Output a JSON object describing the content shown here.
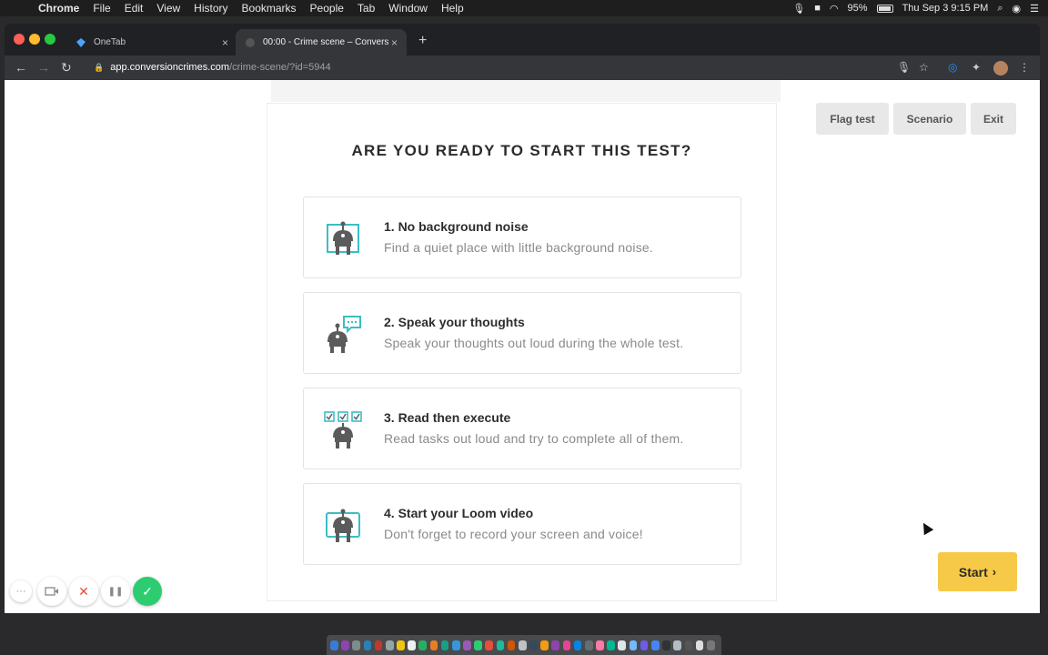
{
  "menubar": {
    "app": "Chrome",
    "items": [
      "File",
      "Edit",
      "View",
      "History",
      "Bookmarks",
      "People",
      "Tab",
      "Window",
      "Help"
    ],
    "battery": "95%",
    "clock": "Thu Sep 3  9:15 PM"
  },
  "tabs": [
    {
      "title": "OneTab",
      "close": "×"
    },
    {
      "title": "00:00 - Crime scene – Convers",
      "close": "×"
    }
  ],
  "new_tab": "+",
  "address": {
    "host": "app.conversioncrimes.com",
    "path": "/crime-scene/?id=5944"
  },
  "page": {
    "heading": "ARE YOU READY TO START THIS TEST?",
    "steps": [
      {
        "title": "1. No background noise",
        "desc": "Find a quiet place with little background noise.",
        "icon": "robot-frame-icon"
      },
      {
        "title": "2. Speak your thoughts",
        "desc": "Speak your thoughts out loud during the whole test.",
        "icon": "robot-speech-icon"
      },
      {
        "title": "3. Read then execute",
        "desc": "Read tasks out loud and try to complete all of them.",
        "icon": "robot-checklist-icon"
      },
      {
        "title": "4. Start your Loom video",
        "desc": "Don't forget to record your screen and voice!",
        "icon": "robot-video-icon"
      }
    ],
    "buttons": {
      "flag": "Flag test",
      "scenario": "Scenario",
      "exit": "Exit",
      "start": "Start"
    }
  },
  "loom": {
    "more": "···",
    "cancel": "✕",
    "pause": "❚❚",
    "done": "✓"
  },
  "colors": {
    "accent_teal": "#3bbec4",
    "icon_grey": "#5b5b5b",
    "start_yellow": "#f7c948",
    "loom_green": "#2ecc71"
  }
}
